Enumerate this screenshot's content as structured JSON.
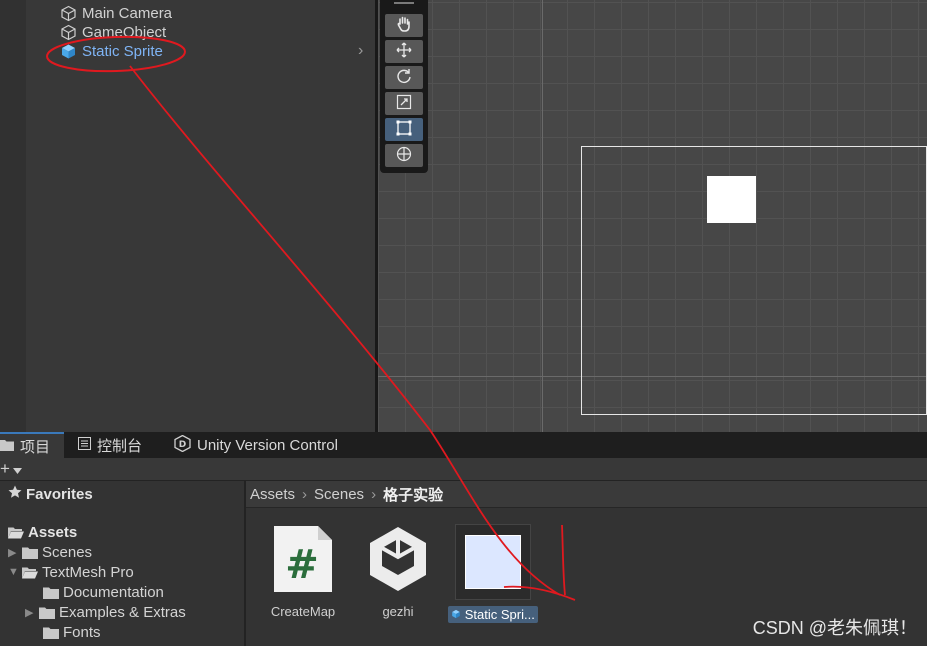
{
  "hierarchy": {
    "items": [
      {
        "label": "Main Camera"
      },
      {
        "label": "GameObject"
      },
      {
        "label": "Static Sprite"
      }
    ]
  },
  "scene": {
    "tools": [
      "hand-tool",
      "move-tool",
      "rotate-tool",
      "scale-tool",
      "rect-tool",
      "transform-tool"
    ],
    "active_tool": "rect-tool"
  },
  "tabs": [
    {
      "label": "项目"
    },
    {
      "label": "控制台"
    },
    {
      "label": "Unity Version Control"
    }
  ],
  "project_toolbar": {
    "plus": "+"
  },
  "tree": {
    "favorites": "Favorites",
    "assets": "Assets",
    "scenes": "Scenes",
    "textmesh": "TextMesh Pro",
    "documentation": "Documentation",
    "examples": "Examples & Extras",
    "fonts": "Fonts"
  },
  "breadcrumb": {
    "root": "Assets",
    "middle": "Scenes",
    "current": "格子实验"
  },
  "assets": [
    {
      "label": "CreateMap",
      "icon": "csharp-script-icon"
    },
    {
      "label": "gezhi",
      "icon": "unity-scene-icon"
    },
    {
      "label": "Static Spri...",
      "icon": "prefab-icon"
    }
  ],
  "watermark": "CSDN @老朱佩琪！",
  "colors": {
    "accent": "#46607c",
    "annotation": "#e0191f",
    "selected_text": "#7fb4f5"
  }
}
